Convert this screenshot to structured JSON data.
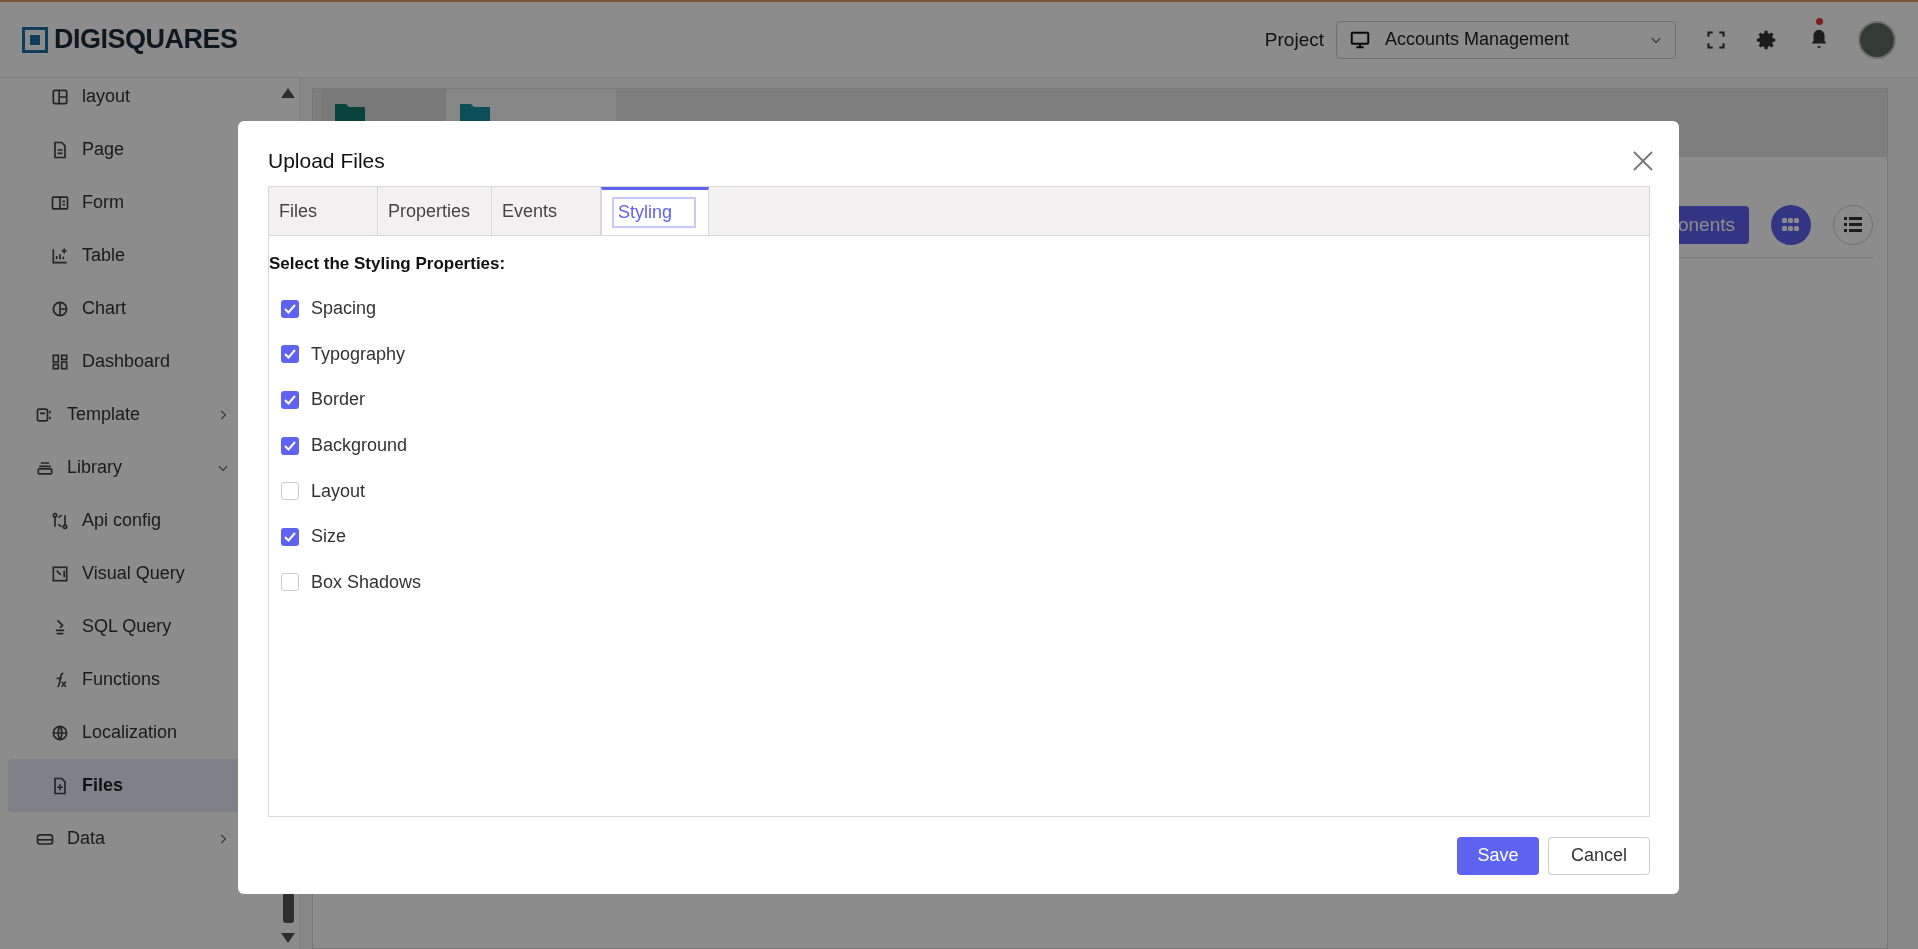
{
  "header": {
    "logo": "DIGISQUARES",
    "project_label": "Project",
    "project_select": "Accounts Management",
    "has_notification": true
  },
  "sidebar": {
    "items": [
      {
        "kind": "child",
        "label": "layout",
        "selected": false
      },
      {
        "kind": "child",
        "label": "Page",
        "selected": false
      },
      {
        "kind": "child",
        "label": "Form",
        "selected": false
      },
      {
        "kind": "child",
        "label": "Table",
        "selected": false
      },
      {
        "kind": "child",
        "label": "Chart",
        "selected": false
      },
      {
        "kind": "child",
        "label": "Dashboard",
        "selected": false
      },
      {
        "kind": "section",
        "label": "Template",
        "expanded": false,
        "selected": false
      },
      {
        "kind": "section",
        "label": "Library",
        "expanded": true,
        "selected": false,
        "children": [
          {
            "kind": "child",
            "label": "Api config",
            "selected": false
          },
          {
            "kind": "child",
            "label": "Visual Query",
            "selected": false
          },
          {
            "kind": "child",
            "label": "SQL Query",
            "selected": false
          },
          {
            "kind": "child",
            "label": "Functions",
            "selected": false
          },
          {
            "kind": "child",
            "label": "Localization",
            "selected": false
          },
          {
            "kind": "child",
            "label": "Files",
            "selected": true
          }
        ]
      },
      {
        "kind": "section",
        "label": "Data",
        "expanded": false,
        "selected": false
      }
    ]
  },
  "toolbar": {
    "add_button": "onents",
    "views": [
      {
        "kind": "grid",
        "selected": true
      },
      {
        "kind": "list",
        "selected": false
      }
    ]
  },
  "dialog": {
    "title": "Upload Files",
    "tabs": [
      {
        "label": "Files",
        "selected": false
      },
      {
        "label": "Properties",
        "selected": false
      },
      {
        "label": "Events",
        "selected": false
      },
      {
        "label": "Styling",
        "selected": true
      }
    ],
    "heading": "Select the Styling Properties:",
    "options": [
      {
        "label": "Spacing",
        "checked": true
      },
      {
        "label": "Typography",
        "checked": true
      },
      {
        "label": "Border",
        "checked": true
      },
      {
        "label": "Background",
        "checked": true
      },
      {
        "label": "Layout",
        "checked": false
      },
      {
        "label": "Size",
        "checked": true
      },
      {
        "label": "Box Shadows",
        "checked": false
      }
    ],
    "buttons": [
      {
        "kind": "primary",
        "label": "Save"
      },
      {
        "kind": "secondary",
        "label": "Cancel"
      }
    ]
  }
}
